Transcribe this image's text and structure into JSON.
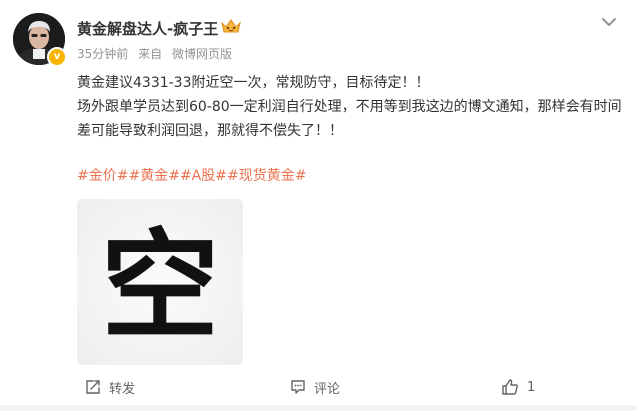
{
  "author": {
    "name": "黄金解盘达人-疯子王"
  },
  "meta": {
    "time": "35分钟前",
    "source_prefix": "来自",
    "source": "微博网页版"
  },
  "content": {
    "line1": "黄金建议4331-33附近空一次，常规防守，目标待定！！",
    "line2": "场外跟单学员达到60-80一定利润自行处理，不用等到我这边的博文通知，那样会有时间差可能导致利润回退，那就得不偿失了！！"
  },
  "tags": [
    "#金价#",
    "#黄金#",
    "#A股#",
    "#现货黄金#"
  ],
  "image": {
    "character": "空"
  },
  "actions": {
    "repost_label": "转发",
    "comment_label": "评论",
    "like_count": "1"
  },
  "colors": {
    "tag": "#eb7350",
    "meta": "#939393",
    "verified": "#f7b500"
  }
}
